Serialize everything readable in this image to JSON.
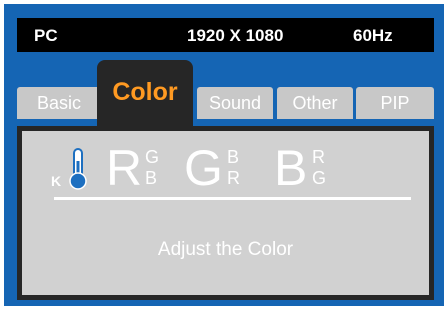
{
  "status": {
    "source": "PC",
    "resolution": "1920 X 1080",
    "refresh": "60Hz"
  },
  "tabs": [
    {
      "label": "Basic",
      "active": false
    },
    {
      "label": "Color",
      "active": true
    },
    {
      "label": "Sound",
      "active": false
    },
    {
      "label": "Other",
      "active": false
    },
    {
      "label": "PIP",
      "active": false
    }
  ],
  "color_panel": {
    "temperature_label": "K",
    "temperature_icon": "thermometer-icon",
    "channels": [
      {
        "main": "R",
        "top": "G",
        "bottom": "B"
      },
      {
        "main": "G",
        "top": "B",
        "bottom": "R"
      },
      {
        "main": "B",
        "top": "R",
        "bottom": "G"
      }
    ],
    "caption": "Adjust the Color"
  },
  "colors": {
    "frame": "#1565b4",
    "active_tab_text": "#ff9a22",
    "thermometer": "#1d6fc0"
  }
}
